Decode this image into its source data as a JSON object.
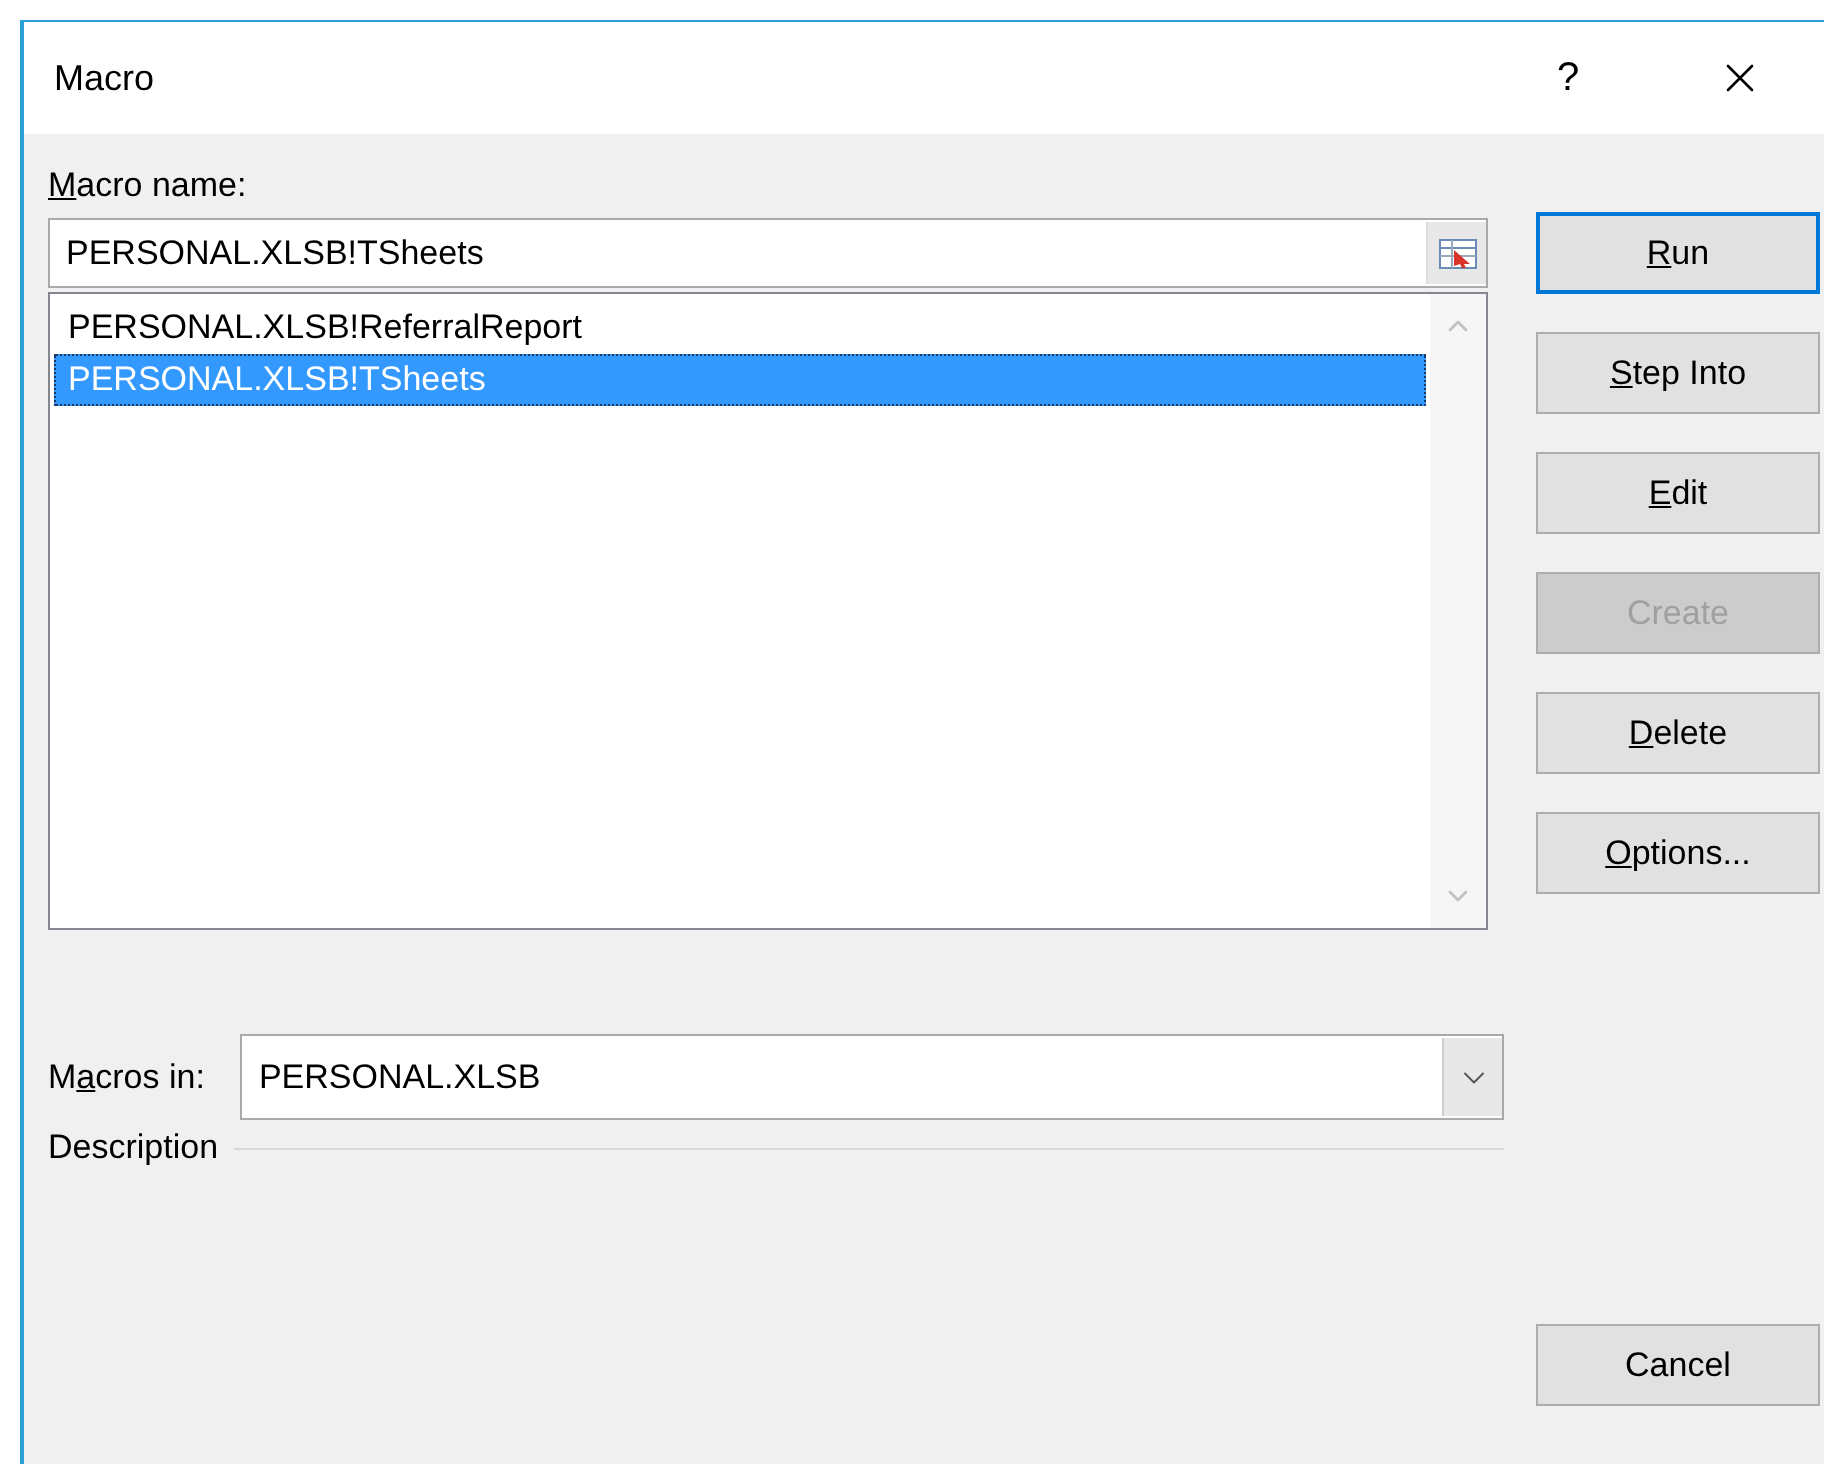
{
  "window": {
    "title": "Macro",
    "help": "?"
  },
  "macro_name": {
    "label": {
      "key": "M",
      "post": "acro name:"
    },
    "value": "PERSONAL.XLSB!TSheets"
  },
  "macro_list": [
    {
      "name": "PERSONAL.XLSB!ReferralReport",
      "selected": false
    },
    {
      "name": "PERSONAL.XLSB!TSheets",
      "selected": true
    }
  ],
  "buttons": [
    {
      "label": {
        "key": "R",
        "post": "un"
      },
      "default": true,
      "disabled": false
    },
    {
      "label": {
        "key": "S",
        "post": "tep Into"
      },
      "default": false,
      "disabled": false
    },
    {
      "label": {
        "key": "E",
        "post": "dit"
      },
      "default": false,
      "disabled": false
    },
    {
      "label": {
        "pre": "Create"
      },
      "default": false,
      "disabled": true
    },
    {
      "label": {
        "key": "D",
        "post": "elete"
      },
      "default": false,
      "disabled": false
    },
    {
      "label": {
        "key": "O",
        "post": "ptions..."
      },
      "default": false,
      "disabled": false
    }
  ],
  "macros_in": {
    "label": {
      "pre": "M",
      "key": "a",
      "post": "cros in:"
    },
    "value": "PERSONAL.XLSB"
  },
  "description": {
    "label": "Description"
  },
  "cancel": {
    "label": "Cancel"
  }
}
